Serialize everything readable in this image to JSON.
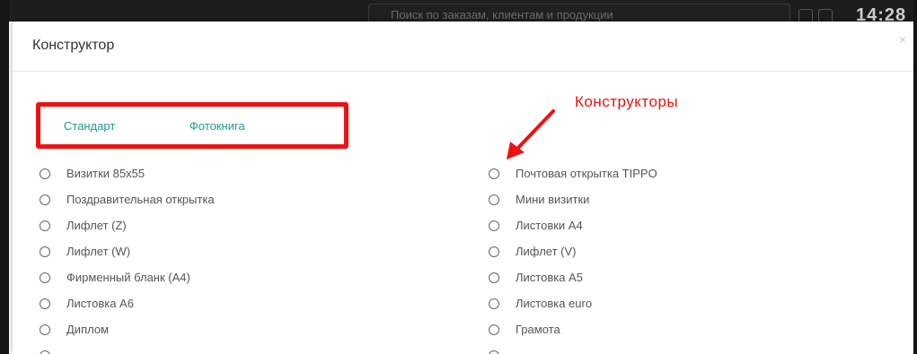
{
  "background": {
    "search_placeholder": "Поиск по заказам, клиентам и продукции",
    "time": "14:28"
  },
  "modal": {
    "title": "Конструктор",
    "close_icon": "close-icon"
  },
  "tabs": [
    {
      "label": "Стандарт"
    },
    {
      "label": "Фотокнига"
    }
  ],
  "annotation": {
    "label": "Конструкторы",
    "color": "#ee1111"
  },
  "options_left": [
    {
      "label": "Визитки 85х55"
    },
    {
      "label": "Поздравительная открытка"
    },
    {
      "label": "Лифлет (Z)"
    },
    {
      "label": "Лифлет (W)"
    },
    {
      "label": "Фирменный бланк (А4)"
    },
    {
      "label": "Листовка А6"
    },
    {
      "label": "Диплом"
    }
  ],
  "options_right": [
    {
      "label": "Почтовая открытка TIPPO"
    },
    {
      "label": "Мини визитки"
    },
    {
      "label": "Листовки А4"
    },
    {
      "label": "Лифлет (V)"
    },
    {
      "label": "Листовка А5"
    },
    {
      "label": "Листовка euro"
    },
    {
      "label": "Грамота"
    }
  ],
  "colors": {
    "accent": "#1a9e8e",
    "highlight": "#ee1111"
  }
}
